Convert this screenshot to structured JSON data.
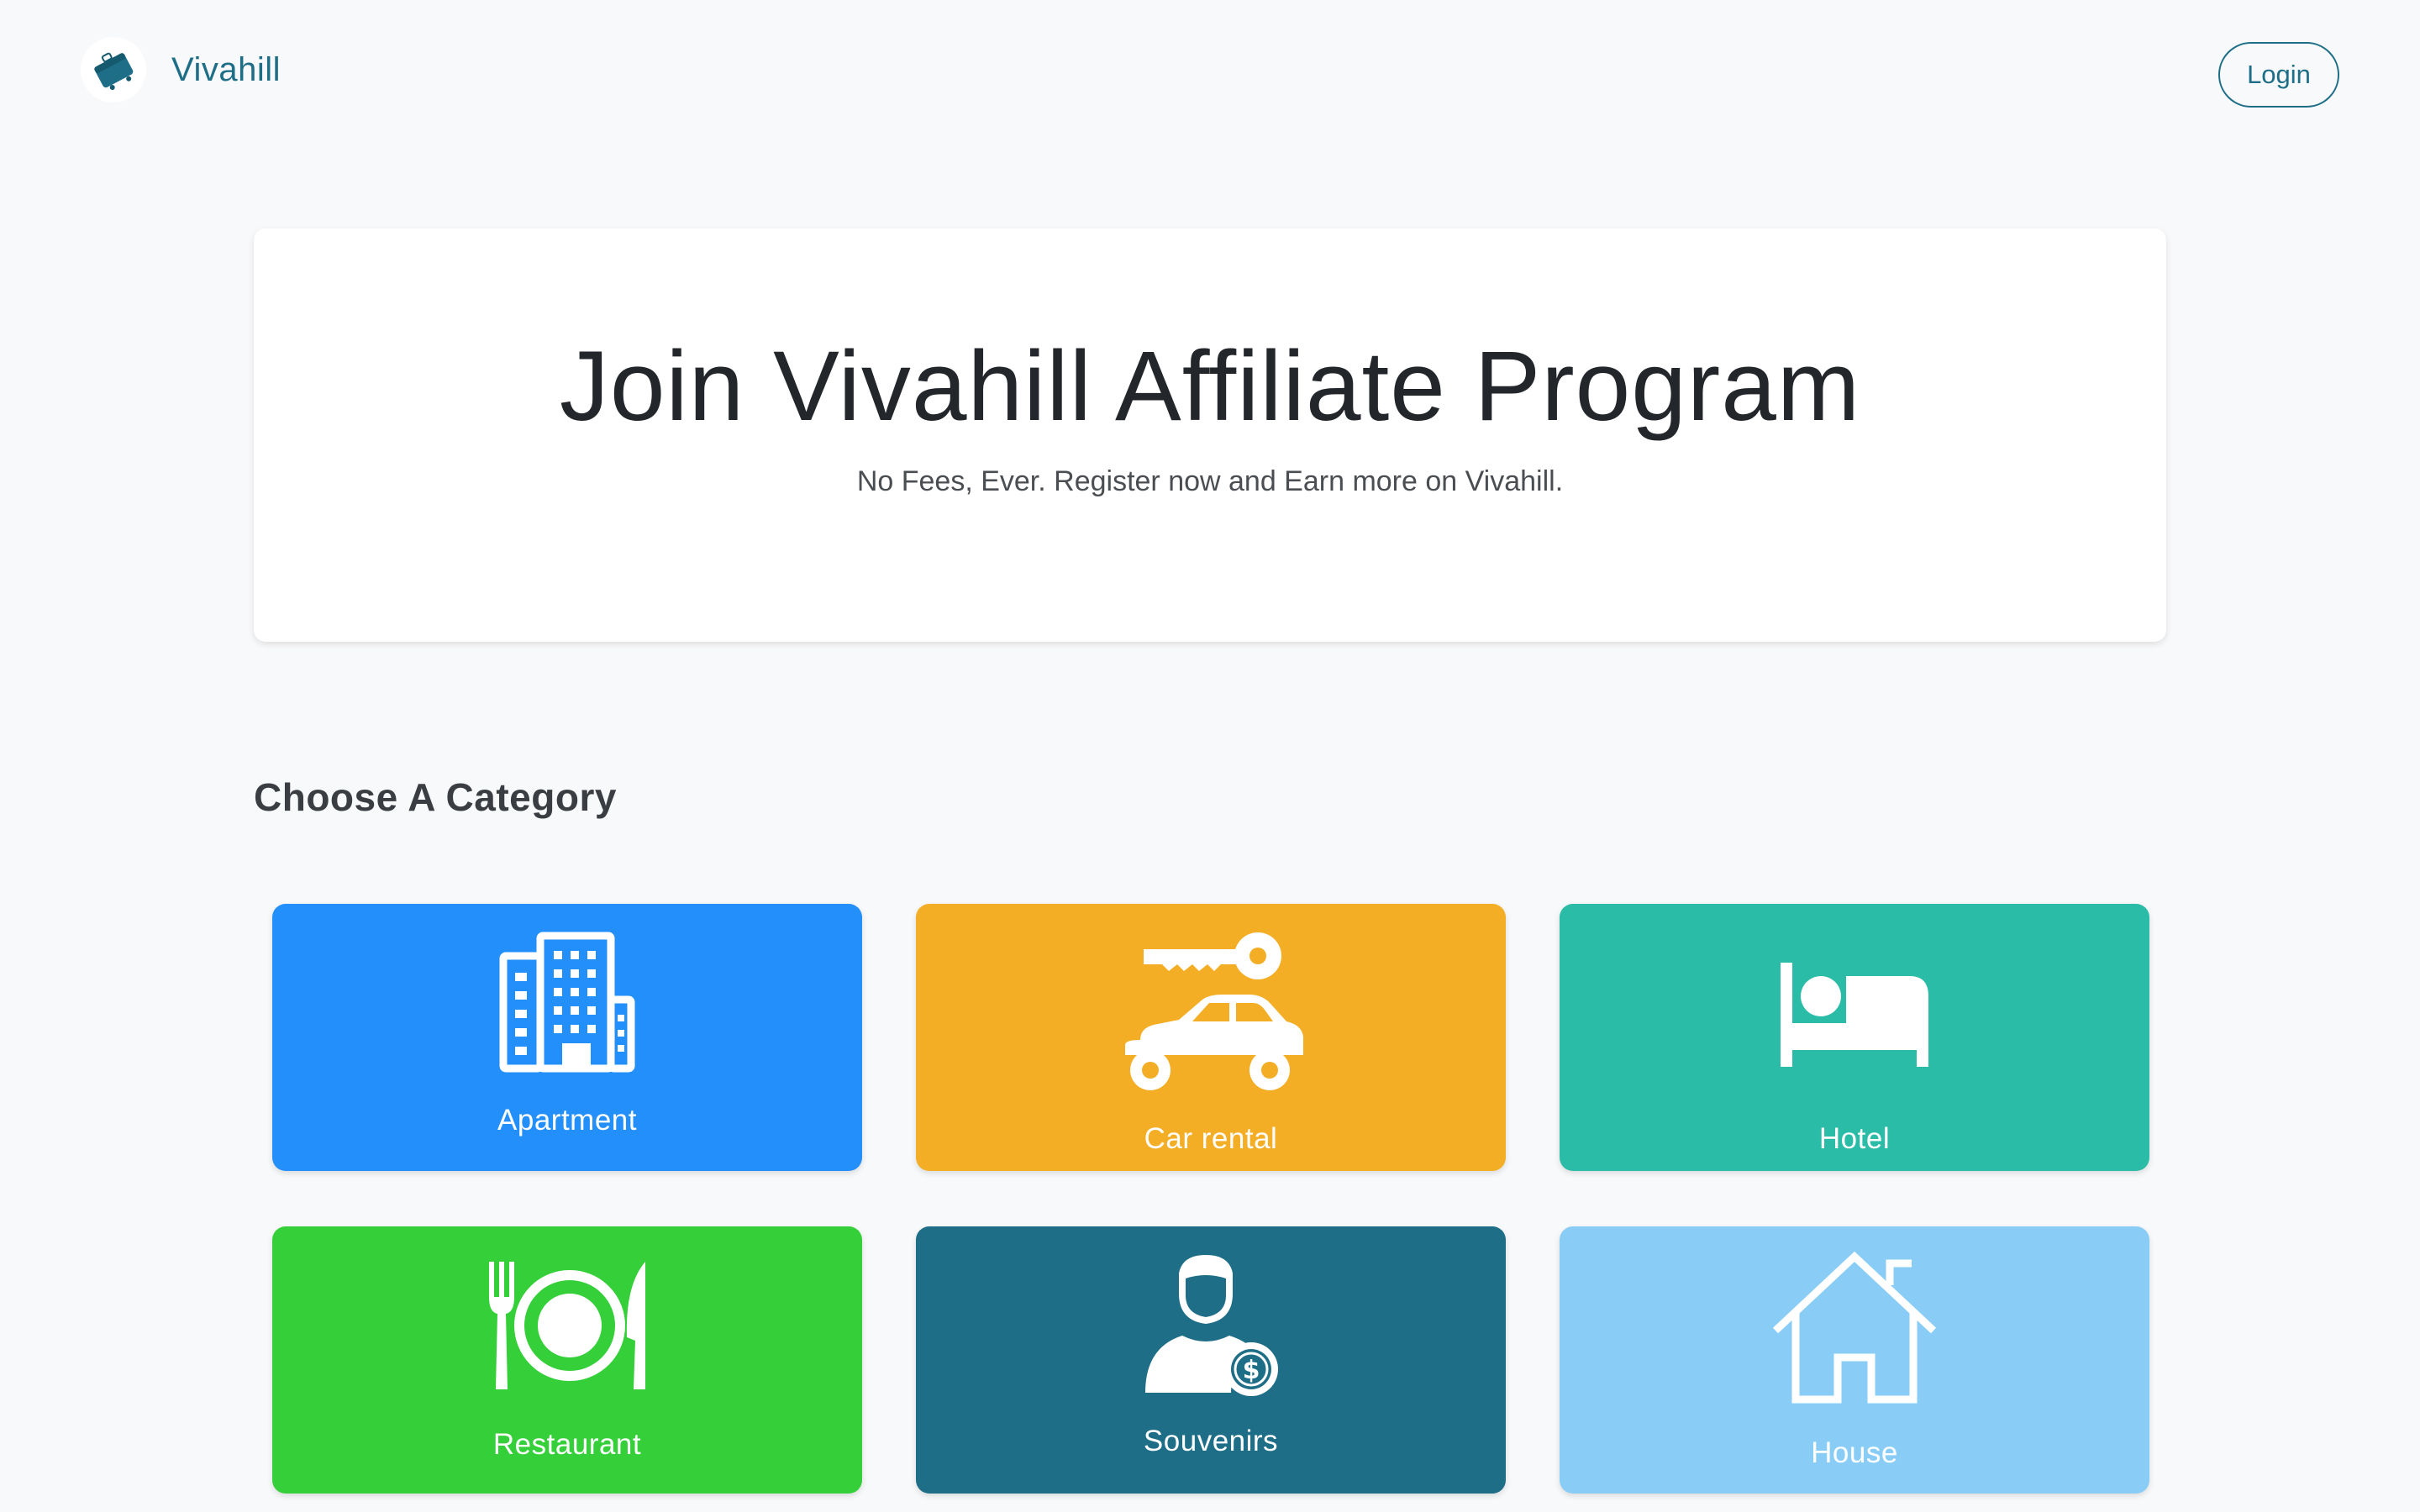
{
  "header": {
    "brand_name": "Vivahill",
    "login_label": "Login"
  },
  "hero": {
    "title": "Join Vivahill Affiliate Program",
    "subtitle": "No Fees, Ever. Register now and Earn more on Vivahill."
  },
  "section": {
    "title": "Choose A Category"
  },
  "categories": [
    {
      "label": "Apartment",
      "color": "#238ffb",
      "icon": "building-icon"
    },
    {
      "label": "Car rental",
      "color": "#f3ae25",
      "icon": "car-key-icon"
    },
    {
      "label": "Hotel",
      "color": "#2bbca7",
      "icon": "bed-icon"
    },
    {
      "label": "Restaurant",
      "color": "#34cf39",
      "icon": "plate-cutlery-icon"
    },
    {
      "label": "Souvenirs",
      "color": "#1d6e86",
      "icon": "person-dollar-icon"
    },
    {
      "label": "House",
      "color": "#89cdf6",
      "icon": "house-icon"
    }
  ],
  "colors": {
    "brand": "#1d6e86",
    "background": "#f8f9fa"
  }
}
